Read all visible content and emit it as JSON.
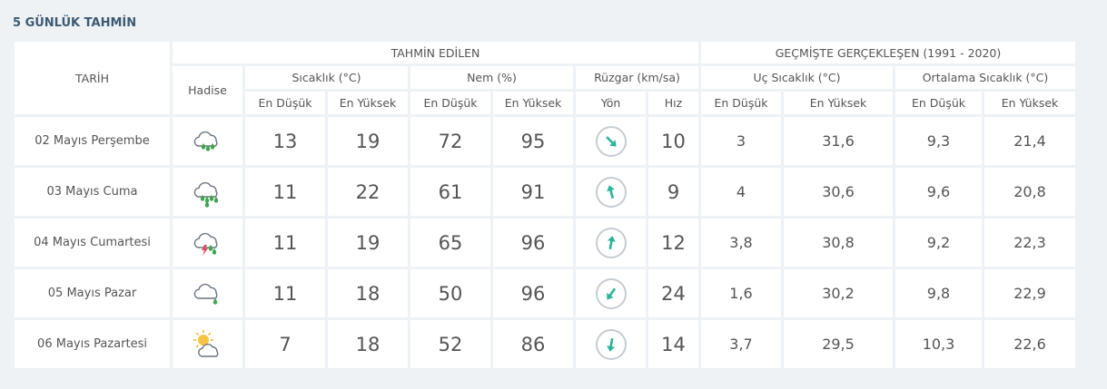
{
  "title": "5 GÜNLÜK TAHMİN",
  "header": {
    "tarih": "TARİH",
    "tahmin_edilen": "TAHMİN EDİLEN",
    "gecmiste": "GEÇMİŞTE GERÇEKLEŞEN (1991 - 2020)",
    "hadise": "Hadise",
    "sicaklik": "Sıcaklık (°C)",
    "nem": "Nem (%)",
    "ruzgar": "Rüzgar (km/sa)",
    "uc_sicaklik": "Uç Sıcaklık (°C)",
    "ort_sicaklik": "Ortalama Sıcaklık (°C)",
    "en_dusuk": "En Düşük",
    "en_yuksek": "En Yüksek",
    "yon": "Yön",
    "hiz": "Hız"
  },
  "colors": {
    "low": "#2d94b8",
    "high": "#e04a5f",
    "humidity_low": "#e0a324",
    "humidity_high": "#8a78b4",
    "wind": "#2db39b"
  },
  "rows": [
    {
      "date": "02 Mayıs Perşembe",
      "icon": "cloud-rain-icon",
      "temp_low": "13",
      "temp_high": "19",
      "hum_low": "72",
      "hum_high": "95",
      "wind_dir_deg": 135,
      "wind_speed": "10",
      "ext_low": "3",
      "ext_high": "31,6",
      "avg_low": "9,3",
      "avg_high": "21,4"
    },
    {
      "date": "03 Mayıs Cuma",
      "icon": "cloud-heavy-rain-icon",
      "temp_low": "11",
      "temp_high": "22",
      "hum_low": "61",
      "hum_high": "91",
      "wind_dir_deg": 345,
      "wind_speed": "9",
      "ext_low": "4",
      "ext_high": "30,6",
      "avg_low": "9,6",
      "avg_high": "20,8"
    },
    {
      "date": "04 Mayıs Cumartesi",
      "icon": "thunderstorm-icon",
      "temp_low": "11",
      "temp_high": "19",
      "hum_low": "65",
      "hum_high": "96",
      "wind_dir_deg": 10,
      "wind_speed": "12",
      "ext_low": "3,8",
      "ext_high": "30,8",
      "avg_low": "9,2",
      "avg_high": "22,3"
    },
    {
      "date": "05 Mayıs Pazar",
      "icon": "cloud-light-rain-icon",
      "temp_low": "11",
      "temp_high": "18",
      "hum_low": "50",
      "hum_high": "96",
      "wind_dir_deg": 215,
      "wind_speed": "24",
      "ext_low": "1,6",
      "ext_high": "30,2",
      "avg_low": "9,8",
      "avg_high": "22,9"
    },
    {
      "date": "06 Mayıs Pazartesi",
      "icon": "partly-cloudy-icon",
      "temp_low": "7",
      "temp_high": "18",
      "hum_low": "52",
      "hum_high": "86",
      "wind_dir_deg": 190,
      "wind_speed": "14",
      "ext_low": "3,7",
      "ext_high": "29,5",
      "avg_low": "10,3",
      "avg_high": "22,6"
    }
  ]
}
